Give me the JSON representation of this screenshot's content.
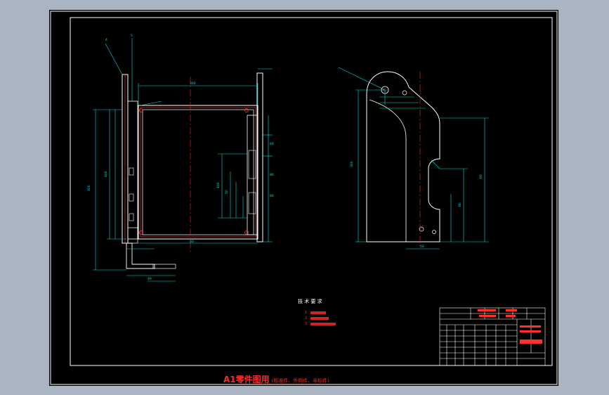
{
  "tech_requirements": {
    "title": "技 术 要 求",
    "items": [
      "1.",
      "2.",
      "3."
    ]
  },
  "caption": {
    "title": "A1零件图用",
    "note": "(标准件、外购件、非标件)"
  },
  "dimensions": [
    "4",
    "5",
    "300",
    "300",
    "400",
    "40",
    "60",
    "60",
    "80",
    "80",
    "100",
    "50"
  ],
  "colors": {
    "background": "#a9b5c3",
    "sheet": "#000000",
    "outline": "#ffffff",
    "dimension": "#00e0e0",
    "centerline": "#ff2020",
    "detail": "#ff5050",
    "annotation": "#ff2a2a",
    "title_block": "#ffffff"
  }
}
